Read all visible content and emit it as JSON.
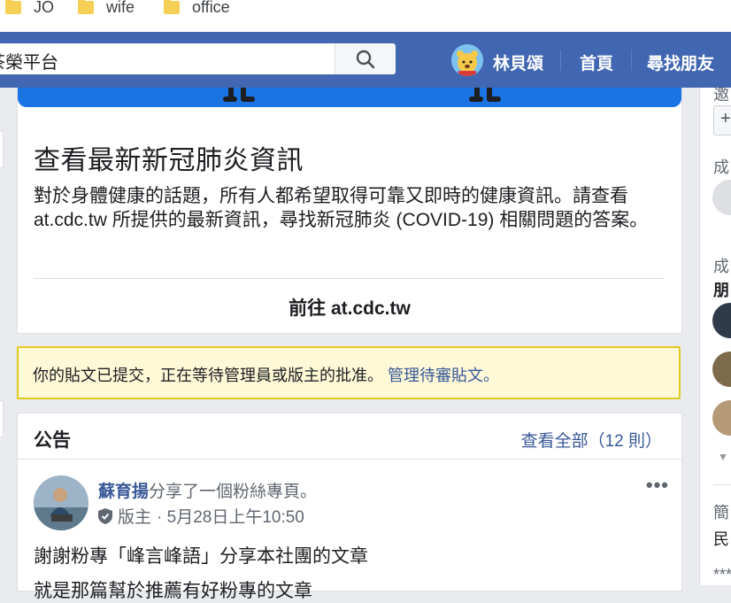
{
  "bookmarks": [
    {
      "label": "JO"
    },
    {
      "label": "wife"
    },
    {
      "label": "office"
    }
  ],
  "topnav": {
    "search_value": "茶榮平台",
    "user_name": "林貝頌",
    "links": [
      "首頁",
      "尋找朋友"
    ]
  },
  "covid": {
    "title": "查看最新新冠肺炎資訊",
    "body": "對於身體健康的話題，所有人都希望取得可靠又即時的健康資訊。請查看 at.cdc.tw 所提供的最新資訊，尋找新冠肺炎 (COVID-19) 相關問題的答案。",
    "link_label": "前往 at.cdc.tw"
  },
  "pending": {
    "text": "你的貼文已提交，正在等待管理員或版主的批准。",
    "link": "管理待審貼文。"
  },
  "announcements": {
    "title": "公告",
    "see_all": "查看全部（12 則）",
    "post": {
      "author": "蘇育揚",
      "action": "分享了一個粉絲專頁。",
      "role": "版主",
      "time": "· 5月28日上午10:50",
      "more": "•••",
      "line1": "謝謝粉專「峰言峰語」分享本社團的文章",
      "line2": "就是那篇幫於推薦有好粉專的文章"
    }
  },
  "right_sidebar": {
    "labels": [
      "邀",
      "成",
      "成",
      "朋",
      "簡",
      "民",
      "***"
    ],
    "plus": "+"
  },
  "colors": {
    "nav_blue": "#4267b2",
    "link_blue": "#385898",
    "pending_bg": "#fff9d7",
    "pending_border": "#e2c822",
    "banner_blue": "#1b74e4"
  }
}
